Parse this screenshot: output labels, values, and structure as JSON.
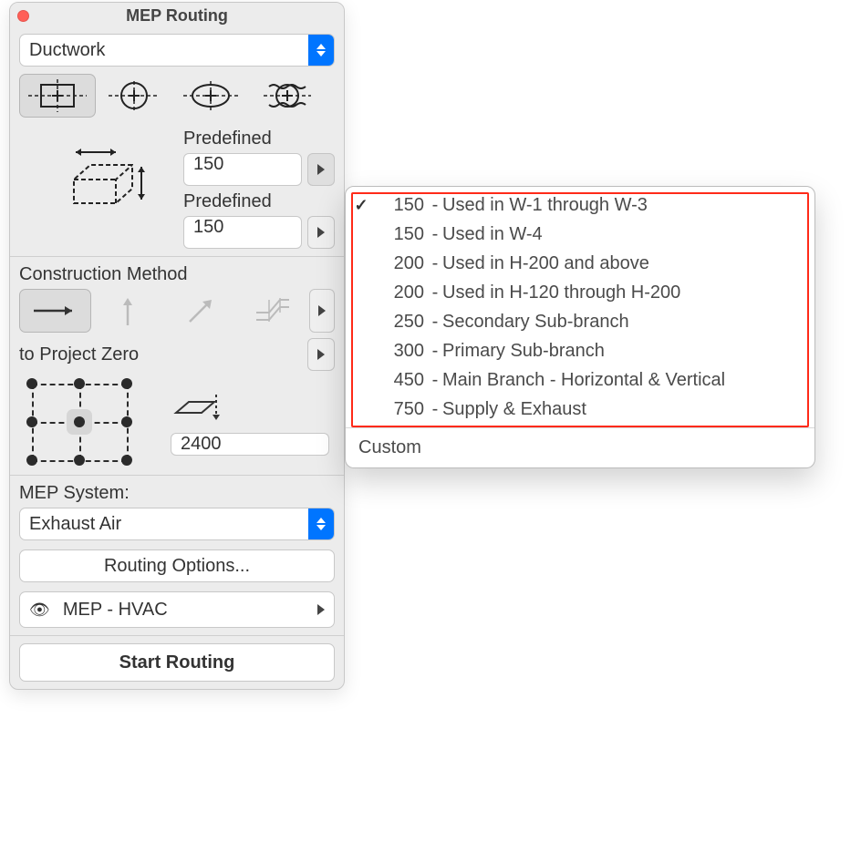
{
  "window": {
    "title": "MEP Routing"
  },
  "top_select": {
    "value": "Ductwork"
  },
  "predefined": {
    "label1": "Predefined",
    "value1": "150",
    "label2": "Predefined",
    "value2": "150"
  },
  "construction": {
    "label": "Construction Method",
    "project_zero_label": "to Project Zero",
    "height_value": "2400"
  },
  "mep": {
    "label": "MEP System:",
    "system": "Exhaust Air",
    "routing_options": "Routing Options...",
    "layer_row": "MEP - HVAC",
    "start": "Start Routing"
  },
  "dropdown": {
    "items": [
      {
        "checked": true,
        "num": "150",
        "desc": "Used in W-1 through W-3"
      },
      {
        "checked": false,
        "num": "150",
        "desc": "Used in W-4"
      },
      {
        "checked": false,
        "num": "200",
        "desc": "Used in H-200 and above"
      },
      {
        "checked": false,
        "num": "200",
        "desc": "Used in H-120 through H-200"
      },
      {
        "checked": false,
        "num": "250",
        "desc": "Secondary Sub-branch"
      },
      {
        "checked": false,
        "num": "300",
        "desc": "Primary Sub-branch"
      },
      {
        "checked": false,
        "num": "450",
        "desc": "Main Branch - Horizontal & Vertical"
      },
      {
        "checked": false,
        "num": "750",
        "desc": "Supply & Exhaust"
      }
    ],
    "custom": "Custom"
  }
}
